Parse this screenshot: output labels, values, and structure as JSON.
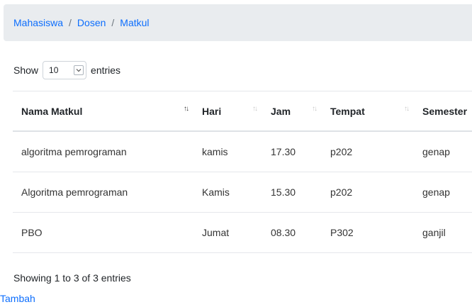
{
  "breadcrumb": {
    "items": [
      "Mahasiswa",
      "Dosen",
      "Matkul"
    ],
    "separator": "/"
  },
  "length_control": {
    "show_label": "Show",
    "selected": "10",
    "entries_label": "entries"
  },
  "table": {
    "columns": [
      "Nama Matkul",
      "Hari",
      "Jam",
      "Tempat",
      "Semester"
    ],
    "rows": [
      [
        "algoritma pemrograman",
        "kamis",
        "17.30",
        "p202",
        "genap"
      ],
      [
        "Algoritma pemrograman",
        "Kamis",
        "15.30",
        "p202",
        "genap"
      ],
      [
        "PBO",
        "Jumat",
        "08.30",
        "P302",
        "ganjil"
      ]
    ]
  },
  "info": "Showing 1 to 3 of 3 entries",
  "actions": {
    "tambah_label": "Tambah"
  },
  "colors": {
    "link": "#0d6efd",
    "breadcrumb_bg": "#e9ecef"
  }
}
